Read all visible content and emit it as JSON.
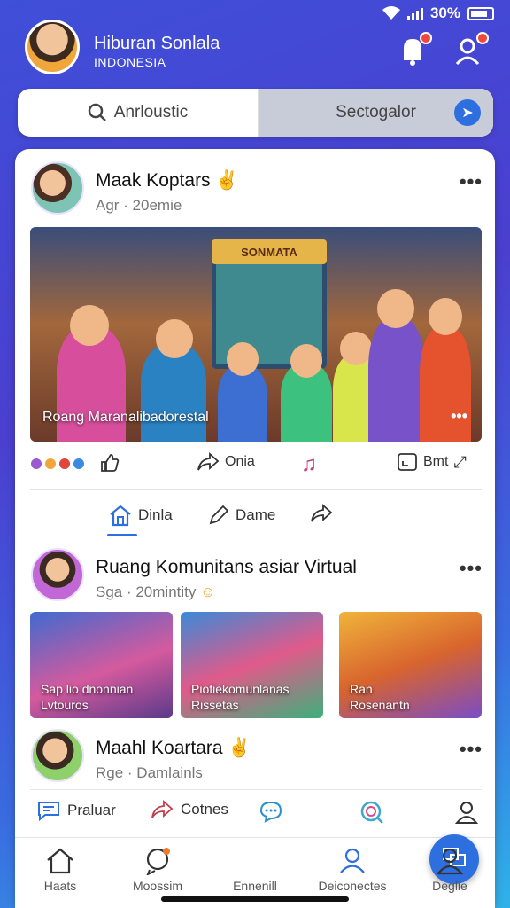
{
  "status": {
    "battery_text": "30%"
  },
  "header": {
    "title": "Hiburan Sonlala",
    "subtitle": "INDONESIA",
    "icons": [
      "bell-icon",
      "friends-icon"
    ]
  },
  "search": {
    "left_label": "Anrloustic",
    "right_label": "Sectogalor"
  },
  "post1": {
    "name": "Maak Koptars",
    "meta": "Agr · 20emie",
    "image_caption": "Roang Maranalibadorestal",
    "screen_sign": "SONMATA",
    "reactions": {
      "share_label": "Onia",
      "right_label": "Bmt"
    },
    "actions": [
      {
        "label": "Dinla"
      },
      {
        "label": "Dame"
      },
      {
        "label": ""
      }
    ]
  },
  "post2": {
    "name": "Ruang Komunitans asiar Virtual",
    "meta": "Sga · 20mintity",
    "thumbs": [
      {
        "line1": "Sap lio dnonnian",
        "line2": "Lvtouros"
      },
      {
        "line1": "Piofiekomunlanas",
        "line2": "Rissetas"
      },
      {
        "line1": "Ran",
        "line2": "Rosenantn"
      }
    ]
  },
  "post3": {
    "name": "Maahl Koartara",
    "meta": "Rge · Damlainls",
    "actions": [
      {
        "label": "Praluar"
      },
      {
        "label": "Cotnes"
      }
    ]
  },
  "tabbar": {
    "tabs": [
      {
        "label": "Haats"
      },
      {
        "label": "Moossim"
      },
      {
        "label": "Ennenill"
      },
      {
        "label": "Deiconectes"
      },
      {
        "label": "Deglie"
      }
    ]
  },
  "colors": {
    "accent": "#2e6fe0",
    "notification": "#f0463b"
  }
}
